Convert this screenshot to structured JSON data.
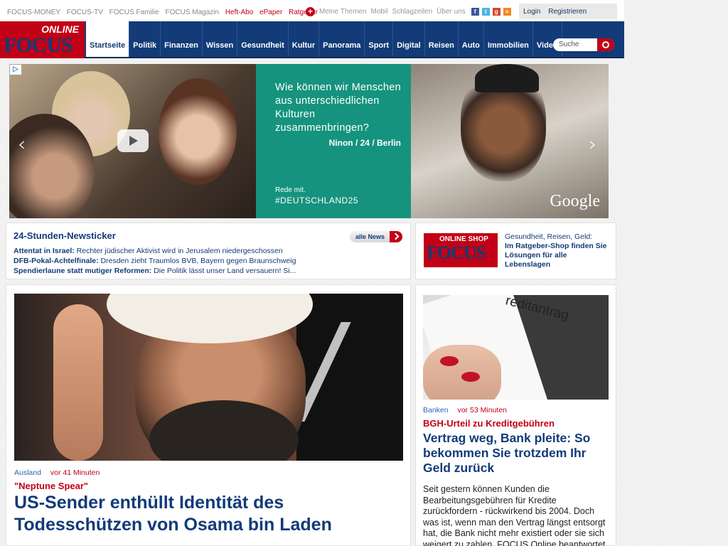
{
  "toplinks": {
    "items": [
      "FOCUS-MONEY",
      "FOCUS-TV",
      "FOCUS Familie",
      "FOCUS Magazin"
    ],
    "red_items": [
      "Heft-Abo",
      "ePaper",
      "Ratgeber"
    ]
  },
  "utility": {
    "meine_themen": "Meine Themen",
    "mobil": "Mobil",
    "schlagzeilen": "Schlagzeilen",
    "ueber_uns": "Über uns"
  },
  "social_icons": [
    "facebook-icon",
    "twitter-icon",
    "googleplus-icon",
    "rss-icon"
  ],
  "account": {
    "login": "Login",
    "register": "Registrieren"
  },
  "logo": {
    "top": "ONLINE",
    "main": "FOCUS"
  },
  "nav": {
    "items": [
      "Startseite",
      "Politik",
      "Finanzen",
      "Wissen",
      "Gesundheit",
      "Kultur",
      "Panorama",
      "Sport",
      "Digital",
      "Reisen",
      "Auto",
      "Immobilien",
      "Video"
    ],
    "active": "Startseite",
    "search_placeholder": "Suche"
  },
  "banner": {
    "question": "Wie können wir Menschen aus unterschiedlichen Kulturen zusammenbringen?",
    "person": "Ninon / 24 / Berlin",
    "rede": "Rede mit.",
    "hashtag": "#DEUTSCHLAND25",
    "brand": "Google"
  },
  "ticker": {
    "title": "24-Stunden-Newsticker",
    "all_news": "alle News",
    "items": [
      {
        "bold": "Attentat in Israel:",
        "text": " Rechter jüdischer Aktivist wird in Jerusalem niedergeschossen"
      },
      {
        "bold": "DFB-Pokal-Achtelfinale:",
        "text": " Dresden zieht Traumlos BVB, Bayern gegen Braunschweig"
      },
      {
        "bold": "Spendierlaune statt mutiger Reformen:",
        "text": " Die Politik lässt unser Land versauern! Si..."
      }
    ]
  },
  "shop": {
    "logo_top": "ONLINE SHOP",
    "logo_main": "FOCUS",
    "line1": "Gesundheit, Reisen, Geld:",
    "line2": "Im Ratgeber-Shop finden Sie Lösungen für alle Lebenslagen"
  },
  "main_article": {
    "category": "Ausland",
    "time": "vor 41 Minuten",
    "kicker": "\"Neptune Spear\"",
    "headline": "US-Sender enthüllt Identität des Todesschützen von Osama bin Laden"
  },
  "side_article": {
    "image_word": "reditantrag",
    "category": "Banken",
    "time": "vor 53 Minuten",
    "kicker": "BGH-Urteil zu Kreditgebühren",
    "headline": "Vertrag weg, Bank pleite: So bekommen Sie trotzdem Ihr Geld zurück",
    "body": "Seit gestern können Kunden die Bearbeitungsgebühren für Kredite zurückfordern - rückwirkend bis 2004. Doch was ist, wenn man den Vertrag längst entsorgt hat, die Bank nicht mehr existiert oder sie sich weigert zu zahlen. FOCUS Online beantwortet"
  },
  "colors": {
    "focus_red": "#c20016",
    "focus_blue": "#123b78",
    "banner_teal": "#15937e"
  }
}
